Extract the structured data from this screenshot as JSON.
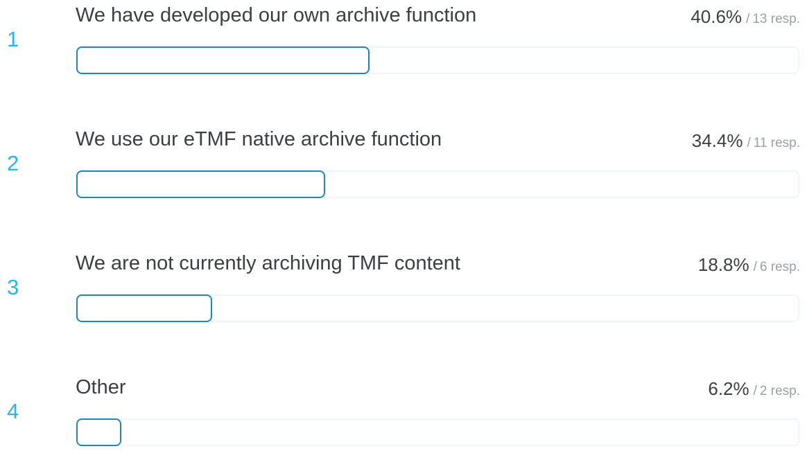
{
  "chart_data": {
    "type": "bar",
    "orientation": "horizontal",
    "categories": [
      "We have developed our own archive function",
      "We use our eTMF native archive function",
      "We are not currently archiving TMF content",
      "Other"
    ],
    "values": [
      40.6,
      34.4,
      18.8,
      6.2
    ],
    "responses": [
      13,
      11,
      6,
      2
    ],
    "xlim": [
      0,
      100
    ]
  },
  "rows": [
    {
      "rank": "1",
      "label": "We have developed our own archive function",
      "percent": "40.6%",
      "separator": "/",
      "responses": "13 resp.",
      "fraction": 0.406
    },
    {
      "rank": "2",
      "label": "We use our eTMF native archive function",
      "percent": "34.4%",
      "separator": "/",
      "responses": "11 resp.",
      "fraction": 0.344
    },
    {
      "rank": "3",
      "label": "We are not currently archiving TMF content",
      "percent": "18.8%",
      "separator": "/",
      "responses": "6 resp.",
      "fraction": 0.188
    },
    {
      "rank": "4",
      "label": "Other",
      "percent": "6.2%",
      "separator": "/",
      "responses": "2 resp.",
      "fraction": 0.062
    }
  ],
  "colors": {
    "rank": "#21b8ee",
    "bar_border": "#1d87b5",
    "track_border": "#eef5f9",
    "label": "#3b3f45",
    "muted": "#9aa0a6"
  }
}
